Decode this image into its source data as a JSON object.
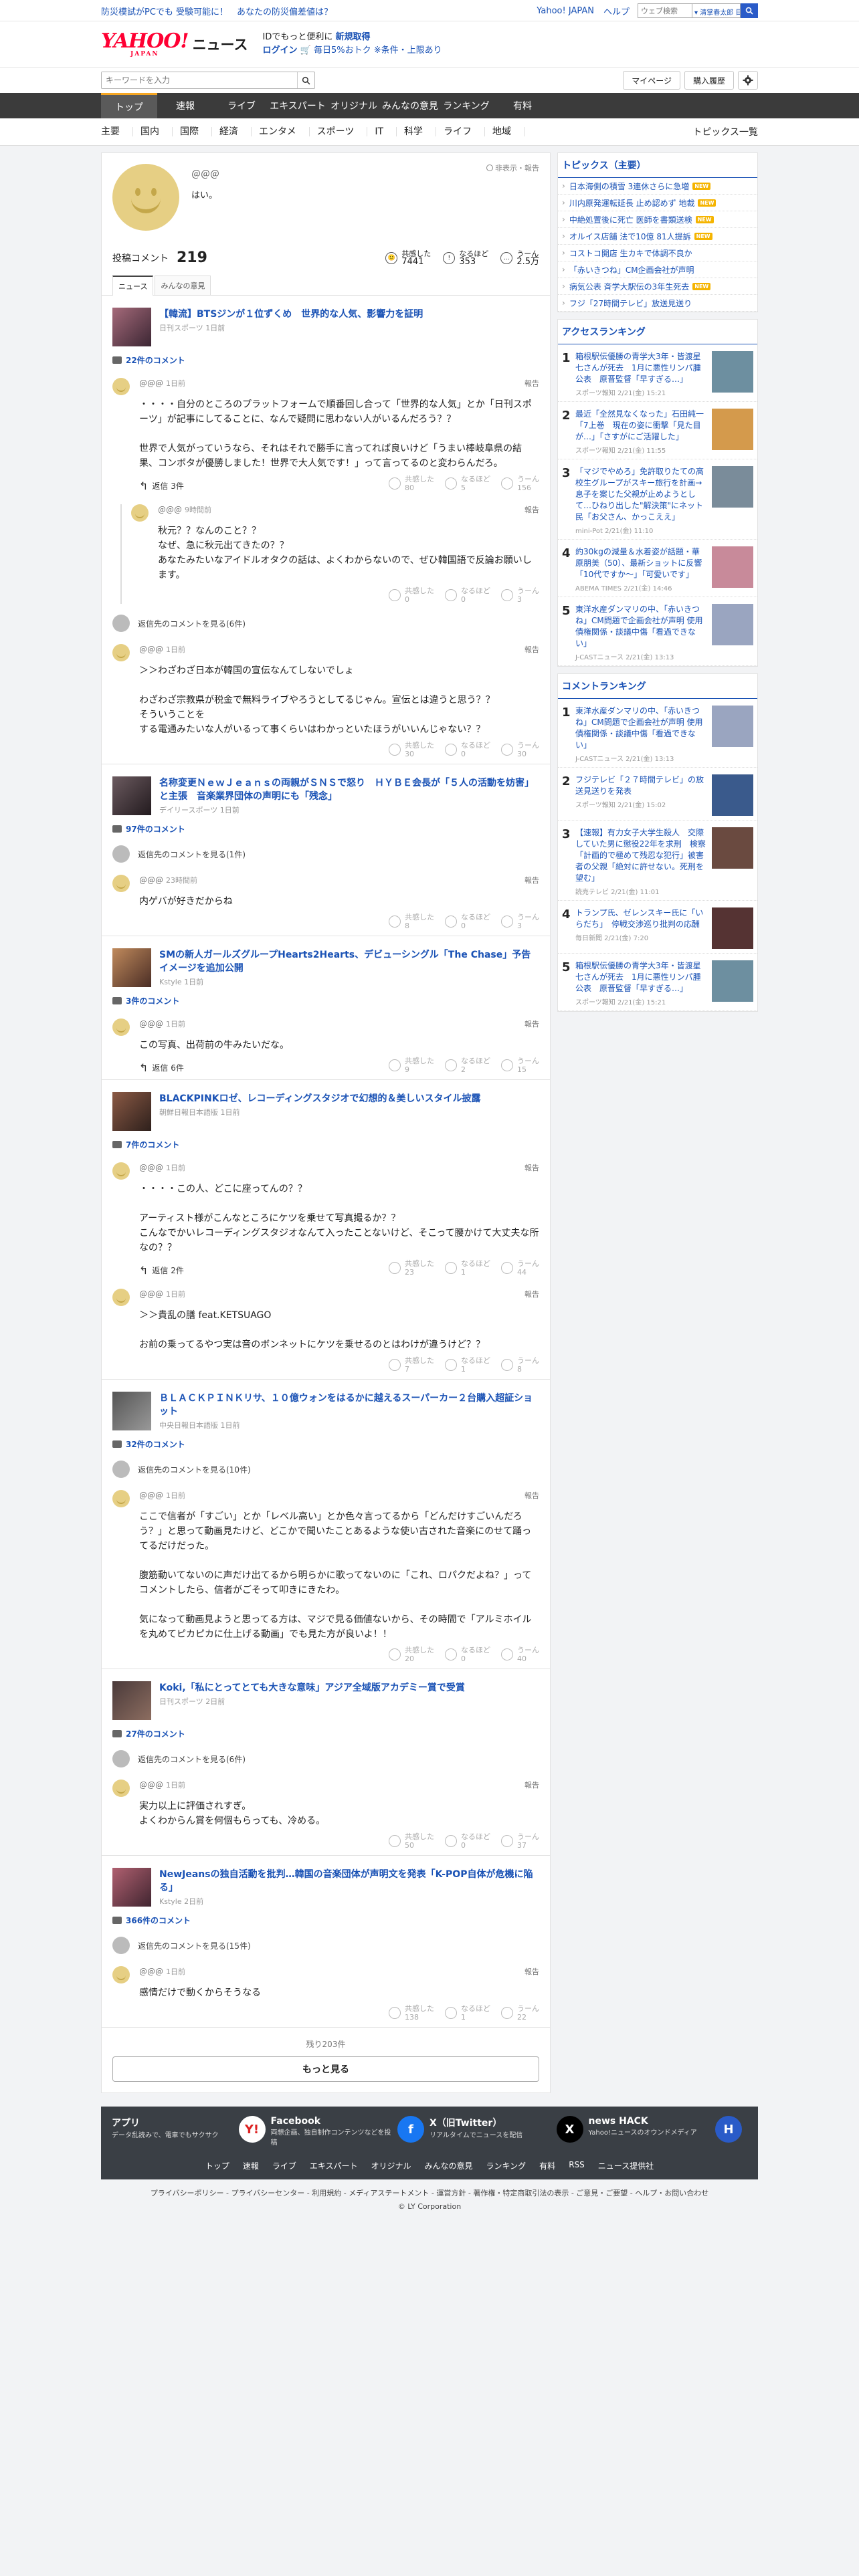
{
  "topbar": {
    "promo": "防災模試がPCでも 受験可能に！　あなたの防災偏差値は？",
    "links": [
      "Yahoo! JAPAN",
      "ヘルプ"
    ],
    "search_placeholder": "ウェブ検索",
    "search_scope": "▾ 清掌春太郎 目..."
  },
  "header": {
    "logo": "YAHOO!",
    "logo_sub": "JAPAN",
    "service": "ニュース",
    "promo_line1": "IDでもっと便利に",
    "promo_bold": "新規取得",
    "promo_login": "ログイン",
    "promo_line2": "🛒 毎日5%おトク ※条件・上限あり"
  },
  "searchrow": {
    "placeholder": "キーワードを入力",
    "mypage": "マイページ",
    "purchased": "購入履歴"
  },
  "mainnav": [
    "トップ",
    "速報",
    "ライブ",
    "エキスパート",
    "オリジナル",
    "みんなの意見",
    "ランキング",
    "有料"
  ],
  "subnav": {
    "items": [
      "主要",
      "国内",
      "国際",
      "経済",
      "エンタメ",
      "スポーツ",
      "IT",
      "科学",
      "ライフ",
      "地域"
    ],
    "topics_all": "トピックス一覧"
  },
  "profile": {
    "name": "＠＠＠",
    "bio": "はい。",
    "report": "非表示・報告",
    "posted_label": "投稿コメント",
    "posted_count": "219",
    "reactions": [
      {
        "label": "共感した",
        "value": "7441",
        "icon": "🙂"
      },
      {
        "label": "なるほど",
        "value": "353",
        "icon": "!"
      },
      {
        "label": "うーん",
        "value": "2.5万",
        "icon": "…"
      }
    ],
    "tabs": [
      "ニュース",
      "みんなの意見"
    ]
  },
  "articles": [
    {
      "title": "【韓流】BTSジンが１位ずくめ　世界的な人気、影響力を証明",
      "source": "日刊スポーツ 1日前",
      "count": "22件のコメント",
      "items": [
        {
          "type": "comment",
          "user": "＠＠＠",
          "date": "1日前",
          "text": "・・・・自分のところのプラットフォームで順番回し合って「世界的な人気」とか「日刊スポーツ」が記事にしてることに、なんで疑問に思わない人がいるんだろう？？\n\n世界で人気がっていうなら、それはそれで勝手に言ってれば良いけど「うまい棒岐阜県の結果、コンボタが優勝しました！世界で大人気です！」って言ってるのと変わらんだろ。",
          "reply": "返信 3件",
          "acts": [
            "80",
            "5",
            "156"
          ]
        },
        {
          "type": "nested",
          "user": "＠＠＠",
          "date": "9時間前",
          "text": "秋元？？なんのこと？？\nなぜ、急に秋元出てきたの？？\nあなたみたいなアイドルオタクの話は、よくわからないので、ぜひ韓国語で反論お願いします。",
          "acts": [
            "0",
            "0",
            "3"
          ]
        },
        {
          "type": "replies",
          "text": "返信先のコメントを見る(6件)"
        },
        {
          "type": "comment",
          "user": "＠＠＠",
          "date": "1日前",
          "text": "＞＞わざわざ日本が韓国の宣伝なんてしないでしょ\n\nわざわざ宗教県が税金で無料ライブやろうとしてるじゃん。宣伝とは違うと思う？？\nそういうことを\nする電通みたいな人がいるって事くらいはわかっといたほうがいいんじゃない？？",
          "acts": [
            "30",
            "0",
            "30"
          ]
        }
      ]
    },
    {
      "title": "名称変更ＮｅｗＪｅａｎｓの両親がＳＮＳで怒り　ＨＹＢＥ会長が「５人の活動を妨害」と主張　音楽業界団体の声明にも「残念」",
      "source": "デイリースポーツ 1日前",
      "count": "97件のコメント",
      "items": [
        {
          "type": "replies",
          "text": "返信先のコメントを見る(1件)"
        },
        {
          "type": "comment",
          "user": "＠＠＠",
          "date": "23時間前",
          "text": "内ゲバが好きだからね",
          "acts": [
            "8",
            "0",
            "3"
          ]
        }
      ]
    },
    {
      "title": "SMの新人ガールズグループHearts2Hearts、デビューシングル「The Chase」予告イメージを追加公開",
      "source": "Kstyle 1日前",
      "count": "3件のコメント",
      "items": [
        {
          "type": "comment",
          "user": "＠＠＠",
          "date": "1日前",
          "text": "この写真、出荷前の牛みたいだな。",
          "reply": "返信 6件",
          "acts": [
            "9",
            "2",
            "15"
          ]
        }
      ]
    },
    {
      "title": "BLACKPINKロゼ、レコーディングスタジオで幻想的＆美しいスタイル披露",
      "source": "朝鮮日報日本語版 1日前",
      "count": "7件のコメント",
      "items": [
        {
          "type": "comment",
          "user": "＠＠＠",
          "date": "1日前",
          "text": "・・・・この人、どこに座ってんの？？\n\nアーティスト様がこんなところにケツを乗せて写真撮るか？？\nこんなでかいレコーディングスタジオなんて入ったことないけど、そこって腰かけて大丈夫な所なの？？",
          "reply": "返信 2件",
          "acts": [
            "23",
            "1",
            "44"
          ]
        },
        {
          "type": "comment",
          "user": "＠＠＠",
          "date": "1日前",
          "text": "＞＞貴乱の膳 feat.KETSUAGO\n\nお前の乗ってるやつ実は音のボンネットにケツを乗せるのとはわけが違うけど？？",
          "acts": [
            "7",
            "1",
            "8"
          ]
        }
      ]
    },
    {
      "title": "ＢＬＡＣＫＰＩＮＫリサ、１０億ウォンをはるかに越えるスーパーカー２台購入超証ショット",
      "source": "中央日報日本語版 1日前",
      "count": "32件のコメント",
      "items": [
        {
          "type": "replies",
          "text": "返信先のコメントを見る(10件)"
        },
        {
          "type": "comment",
          "user": "＠＠＠",
          "date": "1日前",
          "text": "ここで信者が「すごい」とか「レベル高い」とか色々言ってるから「どんだけすごいんだろう？」と思って動画見たけど、どこかで聞いたことあるような使い古された音楽にのせて踊ってるだけだった。\n\n腹筋動いてないのに声だけ出てるから明らかに歌ってないのに「これ、ロパクだよね？」ってコメントしたら、信者がごそって叩きにきたわ。\n\n気になって動画見ようと思ってる方は、マジで見る価値ないから、その時間で「アルミホイルを丸めてピカピカに仕上げる動画」でも見た方が良いよ！！",
          "acts": [
            "20",
            "0",
            "40"
          ]
        }
      ]
    },
    {
      "title": "Koki,「私にとってとても大きな意味」アジア全域版アカデミー賞で受賞",
      "source": "日刊スポーツ 2日前",
      "count": "27件のコメント",
      "items": [
        {
          "type": "replies",
          "text": "返信先のコメントを見る(6件)"
        },
        {
          "type": "comment",
          "user": "＠＠＠",
          "date": "1日前",
          "text": "実力以上に評価されすぎ。\nよくわからん賞を何個もらっても、冷める。",
          "acts": [
            "50",
            "0",
            "37"
          ]
        }
      ]
    },
    {
      "title": "NewJeansの独自活動を批判…韓国の音楽団体が声明文を発表「K-POP自体が危機に陥る」",
      "source": "Kstyle 2日前",
      "count": "366件のコメント",
      "items": [
        {
          "type": "replies",
          "text": "返信先のコメントを見る(15件)"
        },
        {
          "type": "comment",
          "user": "＠＠＠",
          "date": "1日前",
          "text": "感情だけで動くからそうなる",
          "acts": [
            "138",
            "1",
            "22"
          ]
        }
      ]
    }
  ],
  "labels": {
    "report": "報告",
    "empathy": "共感した",
    "naruhodo": "なるほど",
    "hmm": "うーん"
  },
  "more": {
    "remaining": "残り203件",
    "button": "もっと見る"
  },
  "topics": {
    "heading": "トピックス（主要）",
    "items": [
      {
        "text": "日本海側の積雪 3連休さらに急増",
        "new": "NEW"
      },
      {
        "text": "川内原発運転延長 止め認めず 地裁",
        "new": "NEW"
      },
      {
        "text": "中絶処置後に死亡 医師を書類送検",
        "new": "NEW"
      },
      {
        "text": "オルイス店舗 法で10億 81人提訴",
        "new": "NEW"
      },
      {
        "text": "コストコ開店 生カキで体調不良か",
        "new": ""
      },
      {
        "text": "「赤いきつね」CM企画会社が声明",
        "new": ""
      },
      {
        "text": "病気公表 斉学大駅伝の3年生死去",
        "new": "NEW"
      },
      {
        "text": "フジ「27時間テレビ」放送見送り",
        "new": ""
      }
    ]
  },
  "access_ranking": {
    "heading": "アクセスランキング",
    "items": [
      {
        "rank": "1",
        "title": "箱根駅伝優勝の青学大3年・皆渡星七さんが死去　1月に悪性リンパ腫公表　原晋監督「早すぎる…」",
        "src": "スポーツ報知 2/21(金) 15:21"
      },
      {
        "rank": "2",
        "title": "最近「全然見なくなった」石田純一「7上巻　現在の姿に衝撃「見た目が…」「さすがにご活躍した」",
        "src": "スポーツ報知 2/21(金) 11:55"
      },
      {
        "rank": "3",
        "title": "「マジでやめろ」免許取りたての高校生グループがスキー旅行を計画→息子を案じた父親が止めようとして…ひねり出した\"解決策\"にネット民「お父さん、かっこええ」",
        "src": "mini-Pot 2/21(金) 11:10"
      },
      {
        "rank": "4",
        "title": "約30kgの減量＆水着姿が話題・華原朋美（50）、最新ショットに反響「10代ですか～」「可愛いです」",
        "src": "ABEMA TIMES 2/21(金) 14:46"
      },
      {
        "rank": "5",
        "title": "東洋水産ダンマリの中、「赤いきつね」CM問題で企画会社が声明 使用債権関係・談議中傷「看過できない」",
        "src": "J-CASTニュース 2/21(金) 13:13"
      }
    ]
  },
  "comment_ranking": {
    "heading": "コメントランキング",
    "items": [
      {
        "rank": "1",
        "title": "東洋水産ダンマリの中、「赤いきつね」CM問題で企画会社が声明 使用債権関係・談議中傷「看過できない」",
        "src": "J-CASTニュース 2/21(金) 13:13"
      },
      {
        "rank": "2",
        "title": "フジテレビ「２７時間テレビ」の放送見送りを発表",
        "src": "スポーツ報知 2/21(金) 15:02"
      },
      {
        "rank": "3",
        "title": "【速報】有力女子大学生殺人　交際していた男に懲役22年を求刑　検察「計画的で極めて残忍な犯行」被害者の父親「絶対に許せない。死刑を望む」",
        "src": "読売テレビ 2/21(金) 11:01"
      },
      {
        "rank": "4",
        "title": "トランプ氏、ゼレンスキー氏に「いらだち」　停戦交渉巡り批判の応酬",
        "src": "毎日新聞 2/21(金) 7:20"
      },
      {
        "rank": "5",
        "title": "箱根駅伝優勝の青学大3年・皆渡星七さんが死去　1月に悪性リンパ腫公表　原晋監督「早すぎる…」",
        "src": "スポーツ報知 2/21(金) 15:21"
      }
    ]
  },
  "footer": {
    "services": [
      {
        "name": "アプリ",
        "desc": "データ乱読みで、電車でもサクサク",
        "icon": "Y!"
      },
      {
        "name": "Facebook",
        "desc": "両想企画、独自制作コンテンツなどを投稿",
        "icon": "f"
      },
      {
        "name": "X（旧Twitter）",
        "desc": "リアルタイムでニュースを配信",
        "icon": "X"
      },
      {
        "name": "news HACK",
        "desc": "Yahoo!ニュースのオウンドメディア",
        "icon": "H"
      }
    ],
    "links": [
      "トップ",
      "速報",
      "ライブ",
      "エキスパート",
      "オリジナル",
      "みんなの意見",
      "ランキング",
      "有料",
      "RSS",
      "ニュース提供社"
    ],
    "legal": "プライバシーポリシー - プライバシーセンター - 利用規約 - メディアステートメント - 運営方針 - 著作権・特定商取引法の表示 - ご意見・ご要望 - ヘルプ・お問い合わせ",
    "copyright": "© LY Corporation"
  }
}
